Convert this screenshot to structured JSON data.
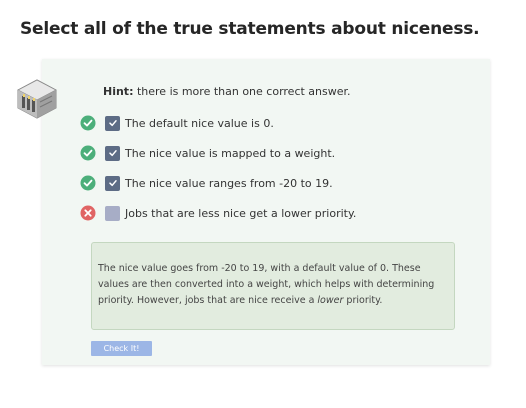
{
  "question": {
    "title": "Select all of the true statements about niceness."
  },
  "hint": {
    "label": "Hint:",
    "text": " there is more than one correct answer."
  },
  "options": [
    {
      "label": "The default nice value is 0.",
      "checked": true,
      "status": "correct"
    },
    {
      "label": "The nice value is mapped to a weight.",
      "checked": true,
      "status": "correct"
    },
    {
      "label": "The nice value ranges from -20 to 19.",
      "checked": true,
      "status": "correct"
    },
    {
      "label": "Jobs that are less nice get a lower priority.",
      "checked": false,
      "status": "incorrect"
    }
  ],
  "explanation": {
    "text_before": "The nice value goes from -20 to 19, with a default value of 0. These values are then converted into a weight, which helps with determining priority. However, jobs that are nice receive a ",
    "emphasis": "lower",
    "text_after": " priority."
  },
  "actions": {
    "check_label": "Check It!"
  },
  "colors": {
    "correct": "#4caf7a",
    "incorrect": "#e06464",
    "checkbox_checked": "#5d6c85",
    "checkbox_unchecked": "#a7adc6",
    "button": "#9cb6e6"
  }
}
